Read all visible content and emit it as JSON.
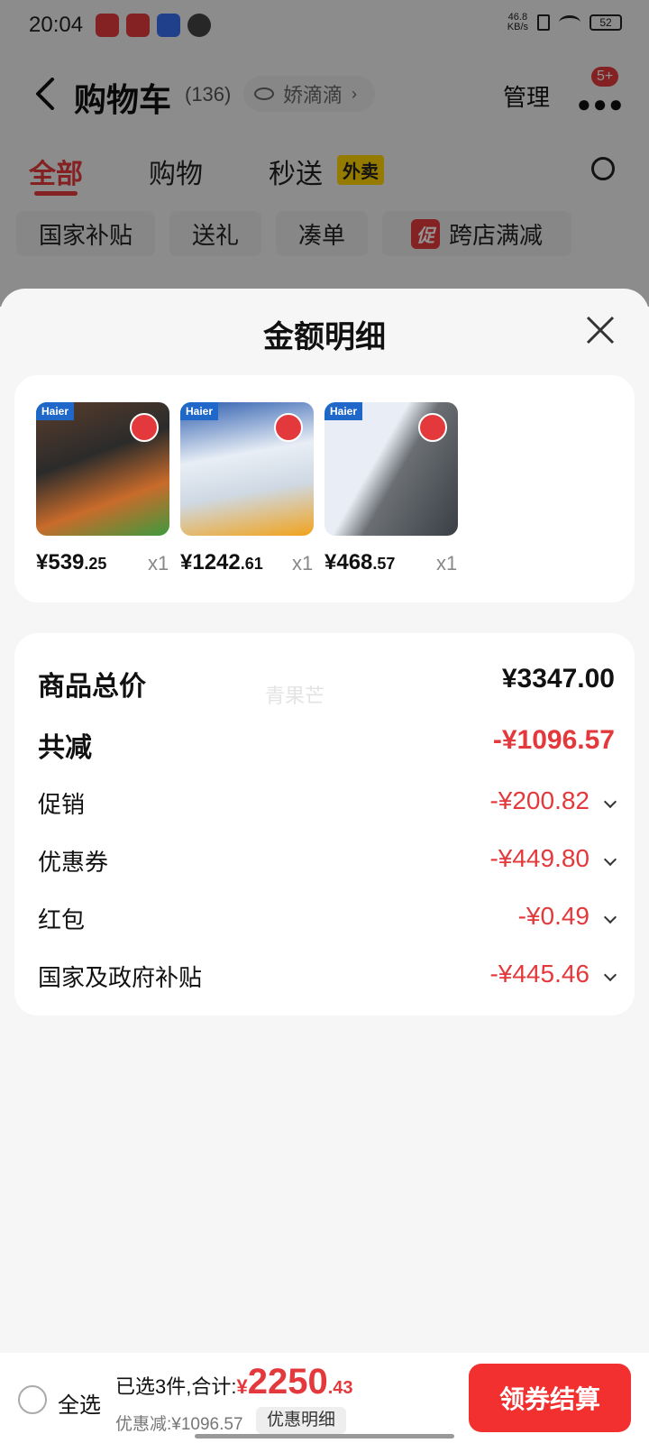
{
  "status_bar": {
    "time": "20:04",
    "net_speed": "46.8\nKB/s",
    "battery": "52"
  },
  "header": {
    "title": "购物车",
    "count": "(136)",
    "account": "娇滴滴",
    "manage": "管理",
    "badge": "5+"
  },
  "tabs": [
    {
      "label": "全部"
    },
    {
      "label": "购物"
    },
    {
      "label": "秒送",
      "tag": "外卖"
    }
  ],
  "filters": [
    "国家补贴",
    "送礼",
    "凑单",
    "跨店满减"
  ],
  "filter_tag": "促",
  "sheet": {
    "title": "金额明细",
    "watermark": "青果芒"
  },
  "products": [
    {
      "price_int": "¥539",
      "price_dec": ".25",
      "qty": "x1",
      "brand": "Haier"
    },
    {
      "price_int": "¥1242",
      "price_dec": ".61",
      "qty": "x1",
      "brand": "Haier"
    },
    {
      "price_int": "¥468",
      "price_dec": ".57",
      "qty": "x1",
      "brand": "Haier"
    }
  ],
  "details": {
    "total_label": "商品总价",
    "total_value": "¥3347.00",
    "reduce_label": "共减",
    "reduce_value": "-¥1096.57",
    "items": [
      {
        "label": "促销",
        "value": "-¥200.82"
      },
      {
        "label": "优惠券",
        "value": "-¥449.80"
      },
      {
        "label": "红包",
        "value": "-¥0.49"
      },
      {
        "label": "国家及政府补贴",
        "value": "-¥445.46"
      }
    ]
  },
  "bottom": {
    "select_all": "全选",
    "summary_prefix": "已选3件,合计:",
    "total_symbol": "¥",
    "total_int": "2250",
    "total_dec": ".43",
    "discount": "优惠减:¥1096.57",
    "discount_btn": "优惠明细",
    "checkout": "领券结算"
  },
  "colors": {
    "accent": "#e4393c",
    "checkout": "#f23030"
  }
}
